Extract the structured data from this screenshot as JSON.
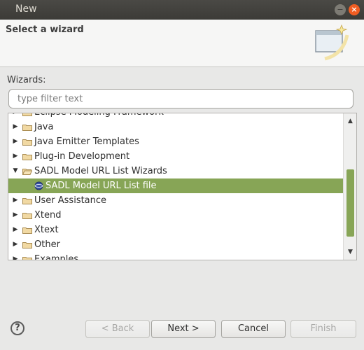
{
  "window": {
    "title": "New"
  },
  "banner": {
    "title": "Select a wizard"
  },
  "wizards_label": "Wizards:",
  "filter": {
    "placeholder": "type filter text",
    "value": ""
  },
  "tree": {
    "items": [
      {
        "label": "Eclipse Modeling Framework",
        "expanded": false
      },
      {
        "label": "Java",
        "expanded": false
      },
      {
        "label": "Java Emitter Templates",
        "expanded": false
      },
      {
        "label": "Plug-in Development",
        "expanded": false
      },
      {
        "label": "SADL Model URL List Wizards",
        "expanded": true
      },
      {
        "label": "SADL Model URL List file",
        "selected": true
      },
      {
        "label": "User Assistance",
        "expanded": false
      },
      {
        "label": "Xtend",
        "expanded": false
      },
      {
        "label": "Xtext",
        "expanded": false
      },
      {
        "label": "Other",
        "expanded": false
      },
      {
        "label": "Examples",
        "expanded": false
      }
    ]
  },
  "buttons": {
    "back": "< Back",
    "next": "Next >",
    "cancel": "Cancel",
    "finish": "Finish"
  },
  "colors": {
    "selection": "#87a556",
    "titlebar": "#3c3b37",
    "close": "#f15d22"
  },
  "icons": {
    "help": "help-icon",
    "folder": "folder-icon",
    "wizard": "wizard-file-icon"
  }
}
